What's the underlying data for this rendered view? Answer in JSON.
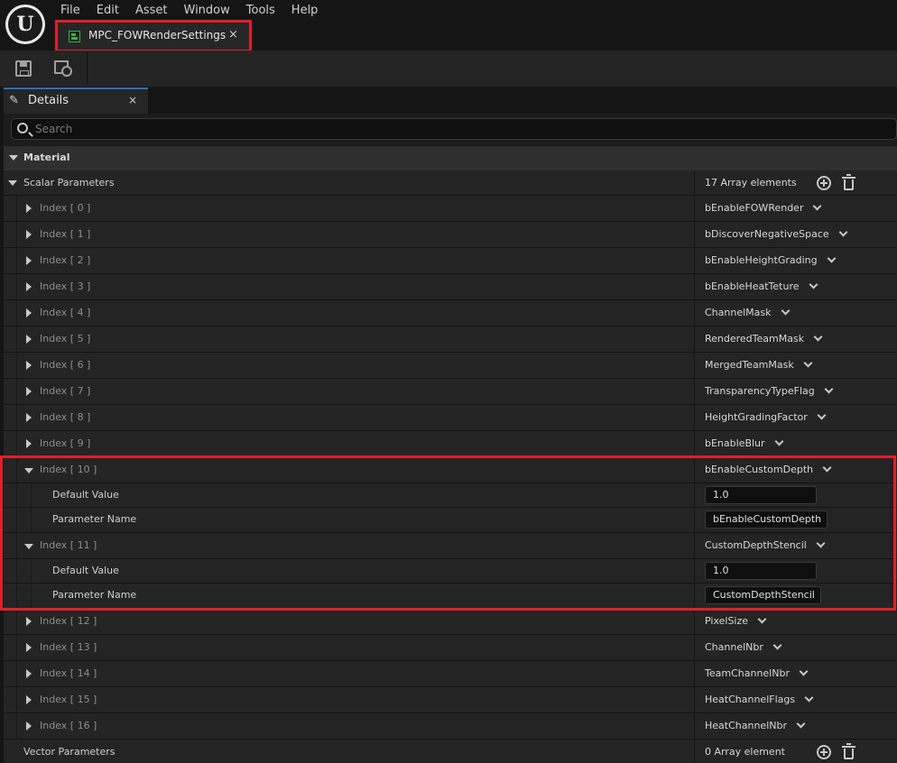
{
  "menu": [
    "File",
    "Edit",
    "Asset",
    "Window",
    "Tools",
    "Help"
  ],
  "asset_tab": {
    "title": "MPC_FOWRenderSettings",
    "close": "×"
  },
  "details_tab": {
    "label": "Details",
    "close": "×",
    "icon": "pencil-icon"
  },
  "search": {
    "placeholder": "Search"
  },
  "category": {
    "label": "Material"
  },
  "scalar": {
    "label": "Scalar Parameters",
    "count": "17 Array elements"
  },
  "vector": {
    "label": "Vector Parameters",
    "count": "0 Array element"
  },
  "indices": [
    {
      "label": "Index [ 0 ]",
      "value": "bEnableFOWRender"
    },
    {
      "label": "Index [ 1 ]",
      "value": "bDiscoverNegativeSpace"
    },
    {
      "label": "Index [ 2 ]",
      "value": "bEnableHeightGrading"
    },
    {
      "label": "Index [ 3 ]",
      "value": "bEnableHeatTeture"
    },
    {
      "label": "Index [ 4 ]",
      "value": "ChannelMask"
    },
    {
      "label": "Index [ 5 ]",
      "value": "RenderedTeamMask"
    },
    {
      "label": "Index [ 6 ]",
      "value": "MergedTeamMask"
    },
    {
      "label": "Index [ 7 ]",
      "value": "TransparencyTypeFlag"
    },
    {
      "label": "Index [ 8 ]",
      "value": "HeightGradingFactor"
    },
    {
      "label": "Index [ 9 ]",
      "value": "bEnableBlur"
    },
    {
      "label": "Index [ 10 ]",
      "value": "bEnableCustomDepth",
      "default_value_label": "Default Value",
      "default_value": "1.0",
      "param_name_label": "Parameter Name",
      "param_name": "bEnableCustomDepth"
    },
    {
      "label": "Index [ 11 ]",
      "value": "CustomDepthStencil",
      "default_value_label": "Default Value",
      "default_value": "1.0",
      "param_name_label": "Parameter Name",
      "param_name": "CustomDepthStencil"
    },
    {
      "label": "Index [ 12 ]",
      "value": "PixelSize"
    },
    {
      "label": "Index [ 13 ]",
      "value": "ChannelNbr"
    },
    {
      "label": "Index [ 14 ]",
      "value": "TeamChannelNbr"
    },
    {
      "label": "Index [ 15 ]",
      "value": "HeatChannelFlags"
    },
    {
      "label": "Index [ 16 ]",
      "value": "HeatChannelNbr"
    }
  ]
}
